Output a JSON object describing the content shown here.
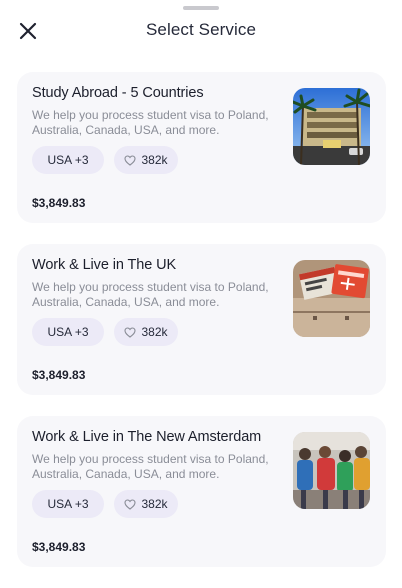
{
  "header": {
    "title": "Select Service"
  },
  "services": [
    {
      "title": "Study Abroad - 5 Countries",
      "description": "We help you process student visa to Poland, Australia, Canada, USA, and more.",
      "countries": "USA +3",
      "likes": "382k",
      "price": "$3,849.83",
      "image_icon": "building-palms-photo"
    },
    {
      "title": "Work & Live in The UK",
      "description": "We help you process student visa to Poland, Australia, Canada, USA, and more.",
      "countries": "USA +3",
      "likes": "382k",
      "price": "$3,849.83",
      "image_icon": "passport-tickets-photo"
    },
    {
      "title": "Work & Live in The New Amsterdam",
      "description": "We help you process student visa to Poland, Australia, Canada, USA, and more.",
      "countries": "USA +3",
      "likes": "382k",
      "price": "$3,849.83",
      "image_icon": "travelers-backpacks-photo"
    }
  ]
}
